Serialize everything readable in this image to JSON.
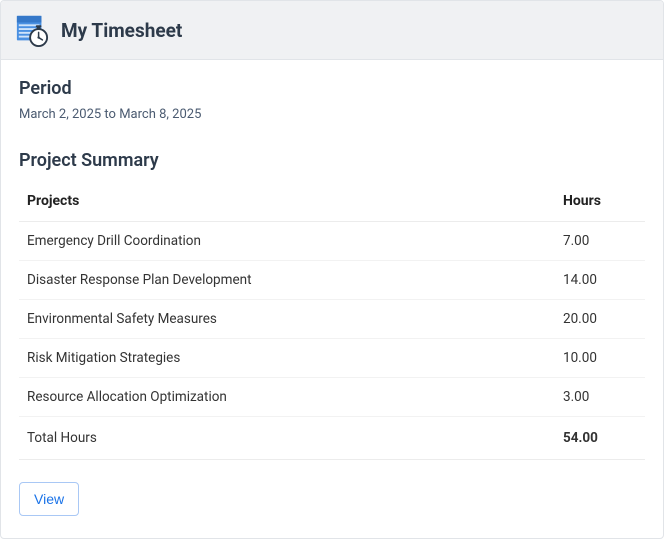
{
  "header": {
    "title": "My Timesheet",
    "icon": "timesheet-clock-icon"
  },
  "period": {
    "label": "Period",
    "range_text": "March 2, 2025 to March 8, 2025"
  },
  "summary": {
    "heading": "Project Summary",
    "columns": {
      "projects": "Projects",
      "hours": "Hours"
    },
    "rows": [
      {
        "project": "Emergency Drill Coordination",
        "hours": "7.00"
      },
      {
        "project": "Disaster Response Plan Development",
        "hours": "14.00"
      },
      {
        "project": "Environmental Safety Measures",
        "hours": "20.00"
      },
      {
        "project": "Risk Mitigation Strategies",
        "hours": "10.00"
      },
      {
        "project": "Resource Allocation Optimization",
        "hours": "3.00"
      }
    ],
    "total": {
      "label": "Total Hours",
      "hours": "54.00"
    }
  },
  "actions": {
    "view_label": "View"
  },
  "colors": {
    "accent": "#1a73e8",
    "header_bg": "#f0f1f3",
    "heading": "#2d3a4a"
  }
}
